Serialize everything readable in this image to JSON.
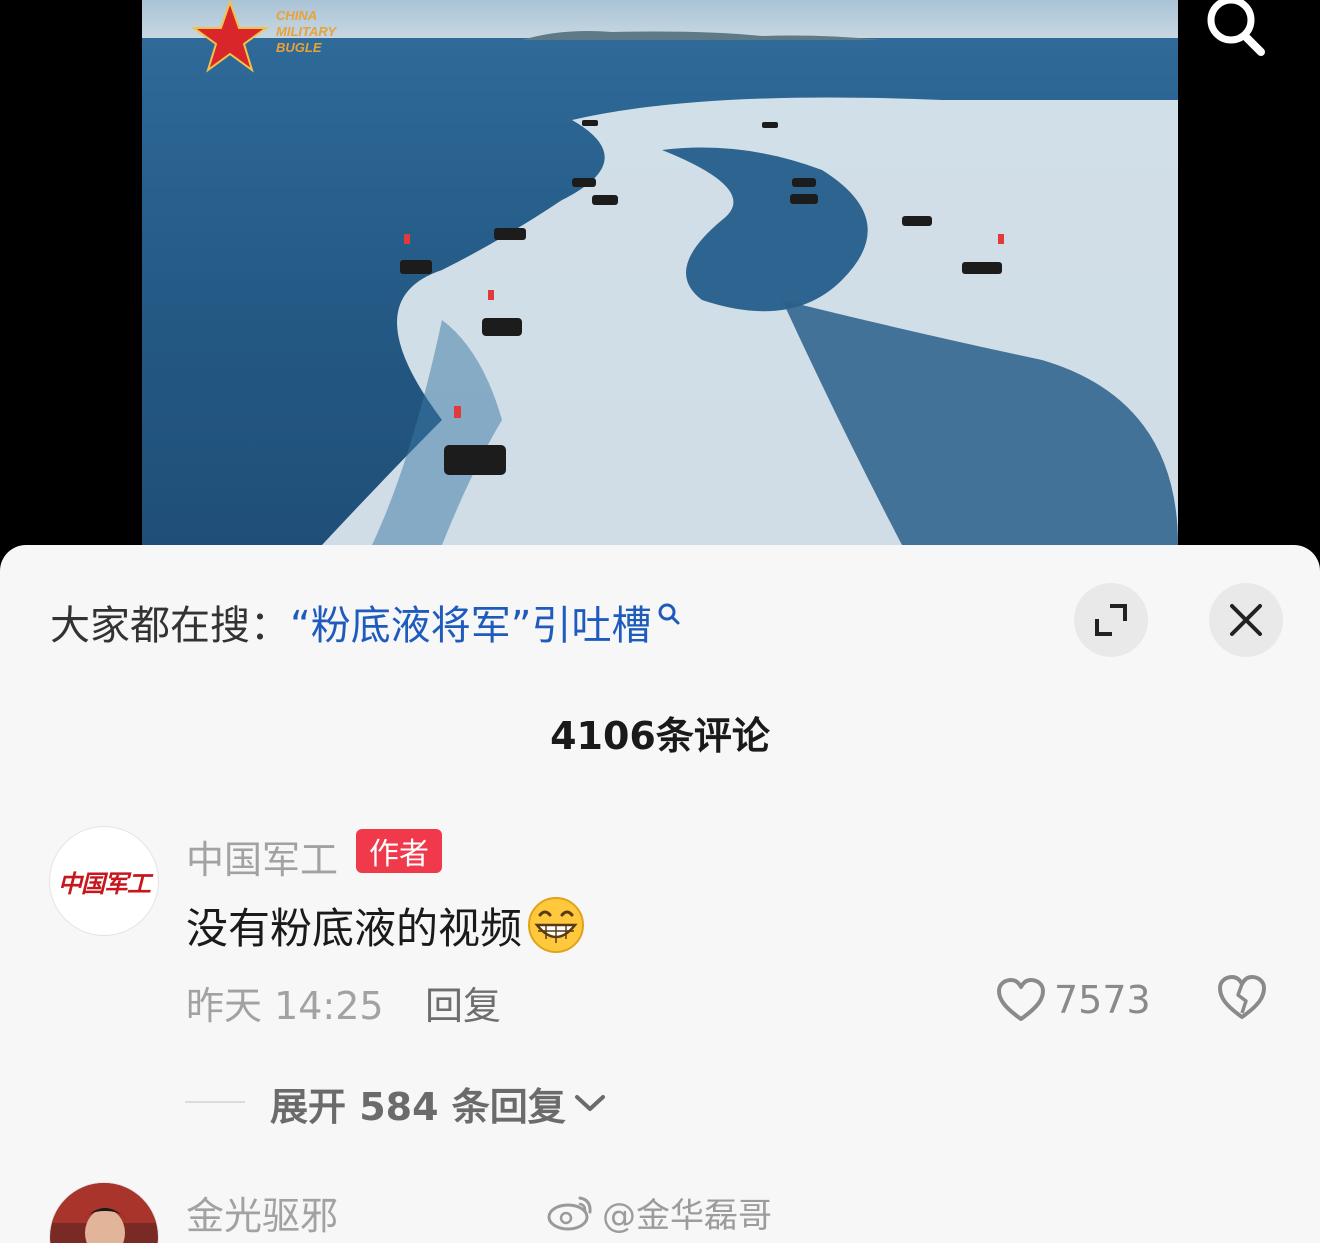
{
  "video": {
    "logo_text": [
      "CHINA",
      "MILITARY",
      "BUGLE"
    ],
    "search_icon": "search-icon"
  },
  "sheet": {
    "trending_prefix": "大家都在搜：",
    "trending_topic": "“粉底液将军”引吐槽",
    "comment_count_title": "4106条评论",
    "comments": [
      {
        "avatar_text": "中国军工",
        "username": "中国军工",
        "badge": "作者",
        "text": "没有粉底液的视频",
        "emoji": "grinning-face-emoji",
        "time": "昨天 14:25",
        "reply_label": "回复",
        "likes": "7573",
        "expand_replies": "展开 584 条回复"
      },
      {
        "username": "金光驱邪"
      }
    ]
  },
  "watermark": "@金华磊哥",
  "colors": {
    "link_blue": "#1e5bbd",
    "badge_red": "#f0394b",
    "sheet_bg": "#f7f7f7"
  }
}
